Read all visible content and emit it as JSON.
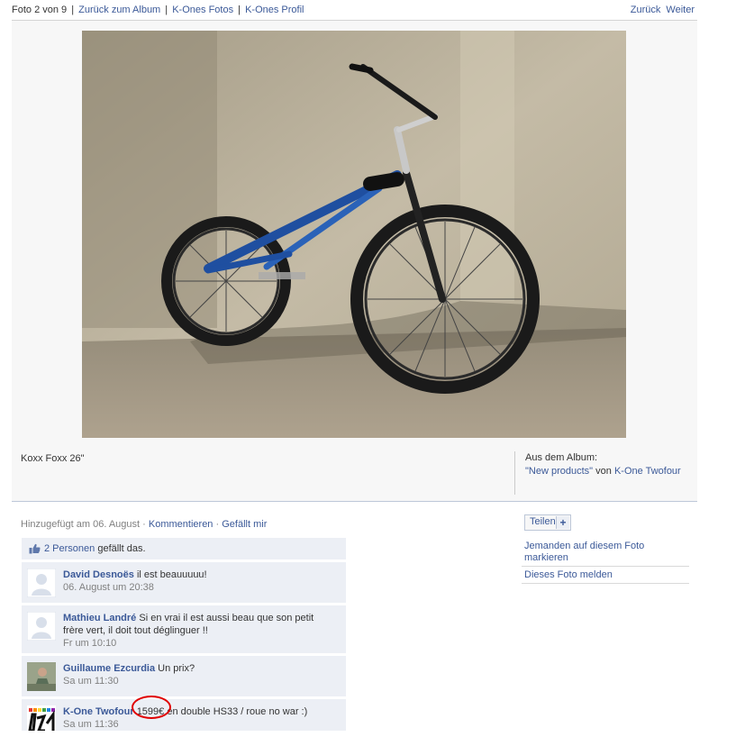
{
  "nav": {
    "position": "Foto 2 von 9",
    "back_album": "Zurück zum Album",
    "photos": "K-Ones Fotos",
    "profile": "K-Ones Profil",
    "prev": "Zurück",
    "next": "Weiter"
  },
  "photo": {
    "caption": "Koxx Foxx 26\"",
    "album_label": "Aus dem Album:",
    "album_name": "\"New products\"",
    "album_by": "von",
    "album_owner": "K-One Twofour"
  },
  "meta": {
    "added": "Hinzugefügt am 06. August",
    "comment": "Kommentieren",
    "like": "Gefällt mir"
  },
  "likes": {
    "count": "2 Personen",
    "suffix": "gefällt das."
  },
  "comments": [
    {
      "author": "David Desnoës",
      "text": "il est beauuuuu!",
      "time": "06. August um 20:38"
    },
    {
      "author": "Mathieu Landré",
      "text": "Si en vrai il est aussi beau que son petit frère vert, il doit tout déglinguer !!",
      "time": "Fr um 10:10"
    },
    {
      "author": "Guillaume Ezcurdia",
      "text": "Un prix?",
      "time": "Sa um 11:30"
    },
    {
      "author": "K-One Twofour",
      "text": "1599€ en double HS33 / roue no war :)",
      "time": "Sa um 11:36"
    }
  ],
  "actions": {
    "share": "Teilen",
    "tag": "Jemanden auf diesem Foto markieren",
    "report": "Dieses Foto melden"
  },
  "colors": {
    "link": "#3b5998",
    "comment_bg": "#eceff5",
    "annotation": "#e00000"
  }
}
